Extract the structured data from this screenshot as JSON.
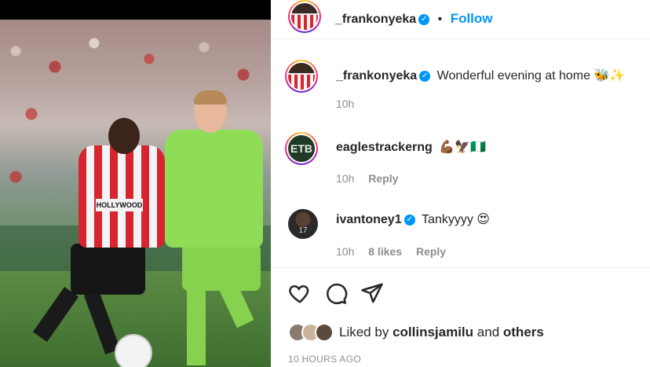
{
  "post": {
    "author": "_frankonyeka",
    "follow_label": "Follow",
    "separator": "•",
    "photo_sponsor": "HOLLYWOOD",
    "caption_user": "_frankonyeka",
    "caption_text": "Wonderful evening at home 🐝✨",
    "caption_time": "10h"
  },
  "comments": [
    {
      "user": "eaglestrackerng",
      "verified": false,
      "text": "💪🏾🦅🇳🇬",
      "time": "10h",
      "likes": "",
      "reply_label": "Reply",
      "avatar_text": "ETB"
    },
    {
      "user": "ivantoney1",
      "verified": true,
      "text": "Tankyyyy 😍",
      "time": "10h",
      "likes": "8 likes",
      "reply_label": "Reply",
      "avatar_text": "17"
    }
  ],
  "likes_bar": {
    "prefix": "Liked by",
    "user": "collinsjamilu",
    "joiner": "and",
    "others": "others"
  },
  "timestamp": "10 HOURS AGO",
  "colors": {
    "accent": "#0095f6",
    "muted": "#8e8e8e",
    "text": "#262626"
  },
  "icons": [
    "heart-icon",
    "comment-icon",
    "share-icon",
    "verified-icon"
  ]
}
